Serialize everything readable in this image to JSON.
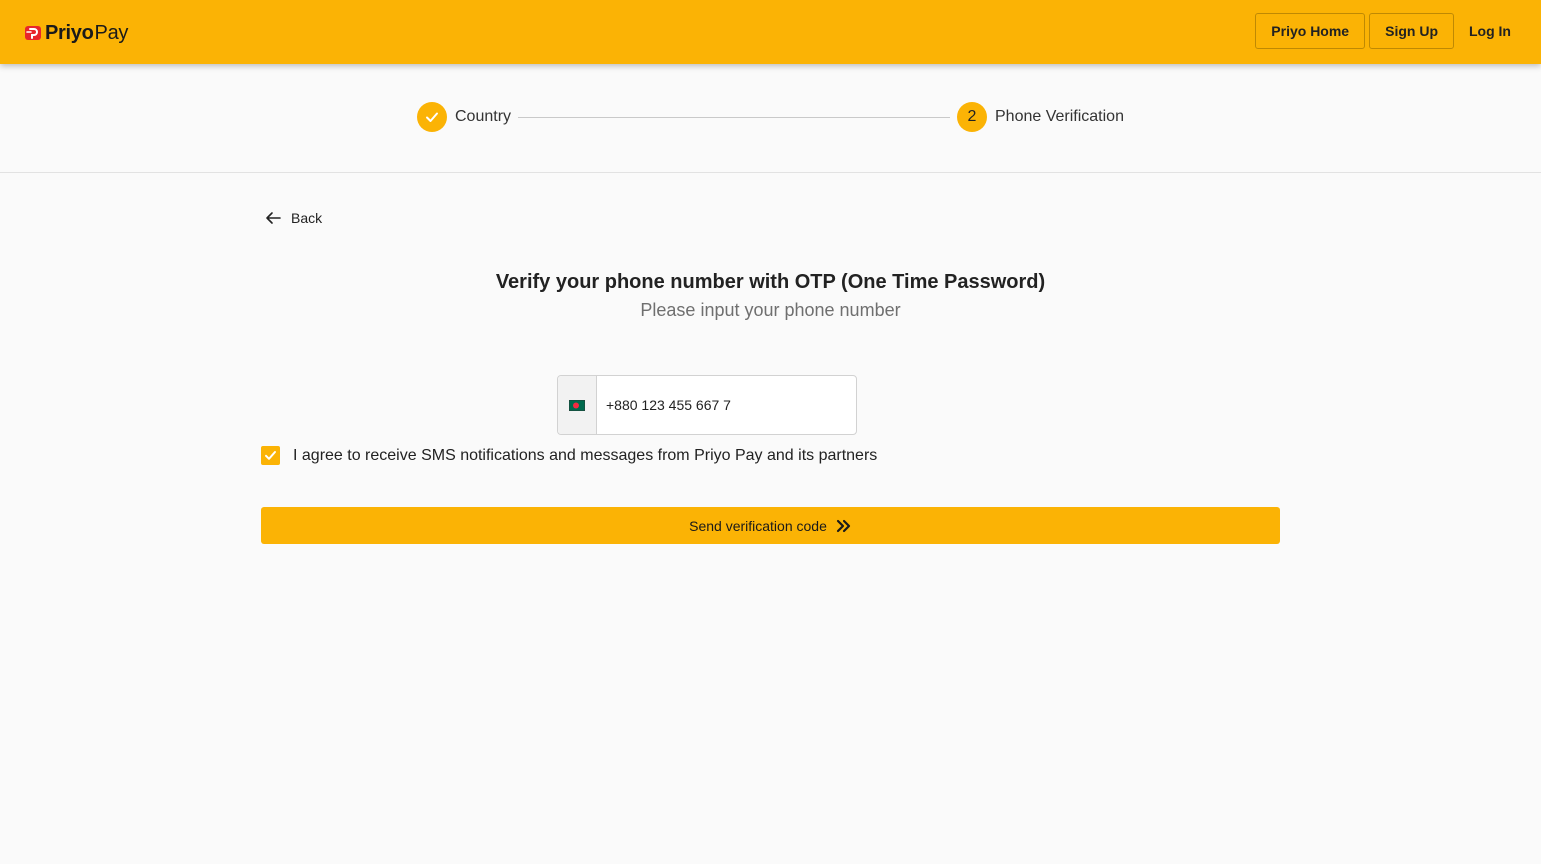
{
  "header": {
    "logo": {
      "strong": "Priyo",
      "light": "Pay"
    },
    "nav": {
      "home_label": "Priyo Home",
      "signup_label": "Sign Up",
      "login_label": "Log In"
    }
  },
  "stepper": {
    "steps": [
      {
        "label": "Country",
        "state": "completed",
        "icon": "check-icon"
      },
      {
        "label": "Phone Verification",
        "state": "active",
        "number": "2"
      }
    ]
  },
  "main": {
    "back_label": "Back",
    "title": "Verify your phone number with OTP (One Time Password)",
    "subtitle": "Please input your phone number",
    "phone": {
      "country_flag": "bangladesh-flag-icon",
      "value": "+880 123 455 667 7"
    },
    "agree": {
      "checked": true,
      "label": "I agree to receive SMS notifications and messages from Priyo Pay and its partners"
    },
    "send_label": "Send verification code"
  },
  "colors": {
    "accent": "#fbb305",
    "background": "#fafafa",
    "logo_red": "#e8262b",
    "flag_green": "#006a4e",
    "flag_red": "#f42a41"
  }
}
